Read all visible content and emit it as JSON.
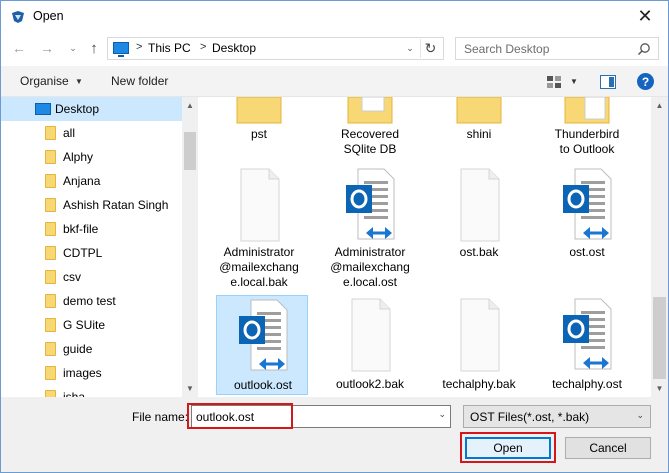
{
  "window": {
    "title": "Open",
    "close_glyph": "✕",
    "accent": "#0078d7",
    "highlight_color": "#d4171d"
  },
  "nav": {
    "back_glyph": "←",
    "forward_glyph": "→",
    "dropdown_glyph": "⌄",
    "up_glyph": "↑",
    "breadcrumbs": [
      "This PC",
      "Desktop"
    ],
    "breadcrumb_sep": ">",
    "address_dropdown_glyph": "⌄",
    "refresh_glyph": "↻",
    "search_placeholder": "Search Desktop"
  },
  "toolbar": {
    "organise_label": "Organise",
    "organise_arrow": "▼",
    "new_folder_label": "New folder",
    "view_arrow": "▼",
    "help_label": "?"
  },
  "sidebar": {
    "items": [
      {
        "label": "Desktop",
        "icon": "desktop-icon",
        "selected": true
      },
      {
        "label": "all",
        "icon": "folder-icon"
      },
      {
        "label": "Alphy",
        "icon": "folder-icon"
      },
      {
        "label": "Anjana",
        "icon": "folder-icon"
      },
      {
        "label": "Ashish Ratan Singh",
        "icon": "folder-icon"
      },
      {
        "label": "bkf-file",
        "icon": "folder-icon"
      },
      {
        "label": "CDTPL",
        "icon": "folder-icon"
      },
      {
        "label": "csv",
        "icon": "folder-icon"
      },
      {
        "label": "demo test",
        "icon": "folder-icon"
      },
      {
        "label": "G SUite",
        "icon": "folder-icon"
      },
      {
        "label": "guide",
        "icon": "folder-icon"
      },
      {
        "label": "images",
        "icon": "folder-icon"
      },
      {
        "label": "isha",
        "icon": "folder-icon"
      }
    ],
    "scroll_up": "▲",
    "scroll_down": "▼"
  },
  "files": {
    "items": [
      {
        "name": "pst",
        "icon": "folder-icon"
      },
      {
        "name": "Recovered SQlite DB",
        "icon": "folder-icon"
      },
      {
        "name": "shini",
        "icon": "folder-icon"
      },
      {
        "name": "Thunderbird to Outlook",
        "icon": "folder-icon"
      },
      {
        "name": "Administrator @mailexchange.local.bak",
        "icon": "blank-file-icon"
      },
      {
        "name": "Administrator @mailexchange.local.ost",
        "icon": "outlook-ost-icon"
      },
      {
        "name": "ost.bak",
        "icon": "blank-file-icon"
      },
      {
        "name": "ost.ost",
        "icon": "outlook-ost-icon"
      },
      {
        "name": "outlook.ost",
        "icon": "outlook-ost-icon",
        "selected": true
      },
      {
        "name": "outlook2.bak",
        "icon": "blank-file-icon"
      },
      {
        "name": "techalphy.bak",
        "icon": "blank-file-icon"
      },
      {
        "name": "techalphy.ost",
        "icon": "outlook-ost-icon"
      }
    ],
    "labels": {
      "pst": [
        "pst"
      ],
      "recovered": [
        "Recovered",
        "SQlite DB"
      ],
      "shini": [
        "shini"
      ],
      "thunderbird": [
        "Thunderbird",
        "to Outlook"
      ],
      "admin_bak": [
        "Administrator",
        "@mailexchang",
        "e.local.bak"
      ],
      "admin_ost": [
        "Administrator",
        "@mailexchang",
        "e.local.ost"
      ],
      "ost_bak": [
        "ost.bak"
      ],
      "ost_ost": [
        "ost.ost"
      ],
      "outlook_ost": [
        "outlook.ost"
      ],
      "outlook2_bak": [
        "outlook2.bak"
      ],
      "techalphy_bak": [
        "techalphy.bak"
      ],
      "techalphy_ost": [
        "techalphy.ost"
      ]
    },
    "scroll_up": "▲",
    "scroll_down": "▼"
  },
  "footer": {
    "file_name_label": "File name:",
    "file_name_value": "outlook.ost",
    "file_name_dropdown": "⌄",
    "file_type_value": "OST Files(*.ost, *.bak)",
    "file_type_dropdown": "⌄",
    "open_label": "Open",
    "cancel_label": "Cancel"
  }
}
